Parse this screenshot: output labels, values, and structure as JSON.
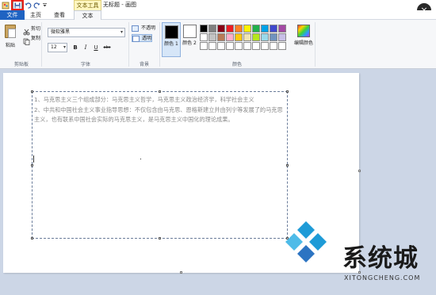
{
  "quick_access": {
    "icons": [
      "paint-app-icon",
      "save-icon",
      "undo-icon",
      "redo-icon",
      "dropdown-icon"
    ]
  },
  "window": {
    "title": "无标题 - 画图",
    "context_tab_group": "文本工具",
    "close_symbol": "×"
  },
  "tabs": [
    "文件",
    "主页",
    "查看",
    "文本"
  ],
  "ribbon": {
    "clipboard": {
      "group_label": "剪贴板",
      "paste": "粘贴",
      "cut": "剪切",
      "copy": "复制"
    },
    "font": {
      "group_label": "字体",
      "family": "微软雅黑",
      "size": "12",
      "bold": "B",
      "italic": "I",
      "underline": "U",
      "strikethrough": "abc"
    },
    "background": {
      "group_label": "背景",
      "opaque": "不透明",
      "transparent": "透明"
    },
    "colors": {
      "group_label": "颜色",
      "color1_label": "颜色 1",
      "color2_label": "颜色 2",
      "color1": "#000000",
      "color2": "#ffffff",
      "edit_label": "编辑颜色",
      "palette": [
        "#000000",
        "#7f7f7f",
        "#880015",
        "#ed1c24",
        "#ff7f27",
        "#fff200",
        "#22b14c",
        "#00a2e8",
        "#3f48cc",
        "#a349a4",
        "#ffffff",
        "#c3c3c3",
        "#b97a57",
        "#ffaec9",
        "#ffc90e",
        "#efe4b0",
        "#b5e61d",
        "#99d9ea",
        "#7092be",
        "#c8bfe7",
        "#ffffff",
        "#ffffff",
        "#ffffff",
        "#ffffff",
        "#ffffff",
        "#ffffff",
        "#ffffff",
        "#ffffff",
        "#ffffff",
        "#ffffff"
      ]
    }
  },
  "canvas": {
    "text_lines": [
      "1、马克思主义三个组成部分：马克思主义哲学，马克思主义政治经济学，科学社会主义",
      "2、中共和中国社会主义事业指导思想：不仅包含由马克思、恩格斯建立并由列宁等发展了的马克思主义，也有联系中国社会实际的马克思主义，是马克思主义中国化的理论成果。"
    ]
  },
  "watermark": {
    "title": "系统城",
    "subtitle": "XITONGCHENG.COM"
  }
}
